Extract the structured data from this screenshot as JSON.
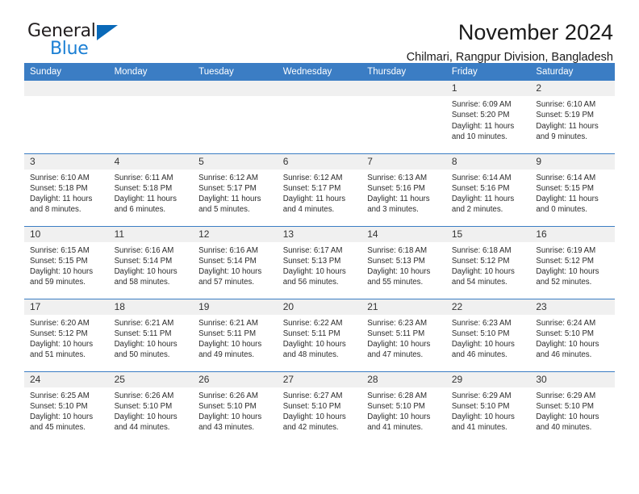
{
  "brand": {
    "name_part1": "General",
    "name_part2": "Blue",
    "triangle_color": "#0a69b8",
    "blue_text_color": "#1b7fd4"
  },
  "header": {
    "title": "November 2024",
    "subtitle": "Chilmari, Rangpur Division, Bangladesh"
  },
  "colors": {
    "header_blue": "#3b7dc4",
    "daynum_gray": "#f0f0f0"
  },
  "weekdays": [
    "Sunday",
    "Monday",
    "Tuesday",
    "Wednesday",
    "Thursday",
    "Friday",
    "Saturday"
  ],
  "weeks": [
    [
      {
        "day": "",
        "sunrise": "",
        "sunset": "",
        "daylight_line1": "",
        "daylight_line2": ""
      },
      {
        "day": "",
        "sunrise": "",
        "sunset": "",
        "daylight_line1": "",
        "daylight_line2": ""
      },
      {
        "day": "",
        "sunrise": "",
        "sunset": "",
        "daylight_line1": "",
        "daylight_line2": ""
      },
      {
        "day": "",
        "sunrise": "",
        "sunset": "",
        "daylight_line1": "",
        "daylight_line2": ""
      },
      {
        "day": "",
        "sunrise": "",
        "sunset": "",
        "daylight_line1": "",
        "daylight_line2": ""
      },
      {
        "day": "1",
        "sunrise": "Sunrise: 6:09 AM",
        "sunset": "Sunset: 5:20 PM",
        "daylight_line1": "Daylight: 11 hours",
        "daylight_line2": "and 10 minutes."
      },
      {
        "day": "2",
        "sunrise": "Sunrise: 6:10 AM",
        "sunset": "Sunset: 5:19 PM",
        "daylight_line1": "Daylight: 11 hours",
        "daylight_line2": "and 9 minutes."
      }
    ],
    [
      {
        "day": "3",
        "sunrise": "Sunrise: 6:10 AM",
        "sunset": "Sunset: 5:18 PM",
        "daylight_line1": "Daylight: 11 hours",
        "daylight_line2": "and 8 minutes."
      },
      {
        "day": "4",
        "sunrise": "Sunrise: 6:11 AM",
        "sunset": "Sunset: 5:18 PM",
        "daylight_line1": "Daylight: 11 hours",
        "daylight_line2": "and 6 minutes."
      },
      {
        "day": "5",
        "sunrise": "Sunrise: 6:12 AM",
        "sunset": "Sunset: 5:17 PM",
        "daylight_line1": "Daylight: 11 hours",
        "daylight_line2": "and 5 minutes."
      },
      {
        "day": "6",
        "sunrise": "Sunrise: 6:12 AM",
        "sunset": "Sunset: 5:17 PM",
        "daylight_line1": "Daylight: 11 hours",
        "daylight_line2": "and 4 minutes."
      },
      {
        "day": "7",
        "sunrise": "Sunrise: 6:13 AM",
        "sunset": "Sunset: 5:16 PM",
        "daylight_line1": "Daylight: 11 hours",
        "daylight_line2": "and 3 minutes."
      },
      {
        "day": "8",
        "sunrise": "Sunrise: 6:14 AM",
        "sunset": "Sunset: 5:16 PM",
        "daylight_line1": "Daylight: 11 hours",
        "daylight_line2": "and 2 minutes."
      },
      {
        "day": "9",
        "sunrise": "Sunrise: 6:14 AM",
        "sunset": "Sunset: 5:15 PM",
        "daylight_line1": "Daylight: 11 hours",
        "daylight_line2": "and 0 minutes."
      }
    ],
    [
      {
        "day": "10",
        "sunrise": "Sunrise: 6:15 AM",
        "sunset": "Sunset: 5:15 PM",
        "daylight_line1": "Daylight: 10 hours",
        "daylight_line2": "and 59 minutes."
      },
      {
        "day": "11",
        "sunrise": "Sunrise: 6:16 AM",
        "sunset": "Sunset: 5:14 PM",
        "daylight_line1": "Daylight: 10 hours",
        "daylight_line2": "and 58 minutes."
      },
      {
        "day": "12",
        "sunrise": "Sunrise: 6:16 AM",
        "sunset": "Sunset: 5:14 PM",
        "daylight_line1": "Daylight: 10 hours",
        "daylight_line2": "and 57 minutes."
      },
      {
        "day": "13",
        "sunrise": "Sunrise: 6:17 AM",
        "sunset": "Sunset: 5:13 PM",
        "daylight_line1": "Daylight: 10 hours",
        "daylight_line2": "and 56 minutes."
      },
      {
        "day": "14",
        "sunrise": "Sunrise: 6:18 AM",
        "sunset": "Sunset: 5:13 PM",
        "daylight_line1": "Daylight: 10 hours",
        "daylight_line2": "and 55 minutes."
      },
      {
        "day": "15",
        "sunrise": "Sunrise: 6:18 AM",
        "sunset": "Sunset: 5:12 PM",
        "daylight_line1": "Daylight: 10 hours",
        "daylight_line2": "and 54 minutes."
      },
      {
        "day": "16",
        "sunrise": "Sunrise: 6:19 AM",
        "sunset": "Sunset: 5:12 PM",
        "daylight_line1": "Daylight: 10 hours",
        "daylight_line2": "and 52 minutes."
      }
    ],
    [
      {
        "day": "17",
        "sunrise": "Sunrise: 6:20 AM",
        "sunset": "Sunset: 5:12 PM",
        "daylight_line1": "Daylight: 10 hours",
        "daylight_line2": "and 51 minutes."
      },
      {
        "day": "18",
        "sunrise": "Sunrise: 6:21 AM",
        "sunset": "Sunset: 5:11 PM",
        "daylight_line1": "Daylight: 10 hours",
        "daylight_line2": "and 50 minutes."
      },
      {
        "day": "19",
        "sunrise": "Sunrise: 6:21 AM",
        "sunset": "Sunset: 5:11 PM",
        "daylight_line1": "Daylight: 10 hours",
        "daylight_line2": "and 49 minutes."
      },
      {
        "day": "20",
        "sunrise": "Sunrise: 6:22 AM",
        "sunset": "Sunset: 5:11 PM",
        "daylight_line1": "Daylight: 10 hours",
        "daylight_line2": "and 48 minutes."
      },
      {
        "day": "21",
        "sunrise": "Sunrise: 6:23 AM",
        "sunset": "Sunset: 5:11 PM",
        "daylight_line1": "Daylight: 10 hours",
        "daylight_line2": "and 47 minutes."
      },
      {
        "day": "22",
        "sunrise": "Sunrise: 6:23 AM",
        "sunset": "Sunset: 5:10 PM",
        "daylight_line1": "Daylight: 10 hours",
        "daylight_line2": "and 46 minutes."
      },
      {
        "day": "23",
        "sunrise": "Sunrise: 6:24 AM",
        "sunset": "Sunset: 5:10 PM",
        "daylight_line1": "Daylight: 10 hours",
        "daylight_line2": "and 46 minutes."
      }
    ],
    [
      {
        "day": "24",
        "sunrise": "Sunrise: 6:25 AM",
        "sunset": "Sunset: 5:10 PM",
        "daylight_line1": "Daylight: 10 hours",
        "daylight_line2": "and 45 minutes."
      },
      {
        "day": "25",
        "sunrise": "Sunrise: 6:26 AM",
        "sunset": "Sunset: 5:10 PM",
        "daylight_line1": "Daylight: 10 hours",
        "daylight_line2": "and 44 minutes."
      },
      {
        "day": "26",
        "sunrise": "Sunrise: 6:26 AM",
        "sunset": "Sunset: 5:10 PM",
        "daylight_line1": "Daylight: 10 hours",
        "daylight_line2": "and 43 minutes."
      },
      {
        "day": "27",
        "sunrise": "Sunrise: 6:27 AM",
        "sunset": "Sunset: 5:10 PM",
        "daylight_line1": "Daylight: 10 hours",
        "daylight_line2": "and 42 minutes."
      },
      {
        "day": "28",
        "sunrise": "Sunrise: 6:28 AM",
        "sunset": "Sunset: 5:10 PM",
        "daylight_line1": "Daylight: 10 hours",
        "daylight_line2": "and 41 minutes."
      },
      {
        "day": "29",
        "sunrise": "Sunrise: 6:29 AM",
        "sunset": "Sunset: 5:10 PM",
        "daylight_line1": "Daylight: 10 hours",
        "daylight_line2": "and 41 minutes."
      },
      {
        "day": "30",
        "sunrise": "Sunrise: 6:29 AM",
        "sunset": "Sunset: 5:10 PM",
        "daylight_line1": "Daylight: 10 hours",
        "daylight_line2": "and 40 minutes."
      }
    ]
  ]
}
